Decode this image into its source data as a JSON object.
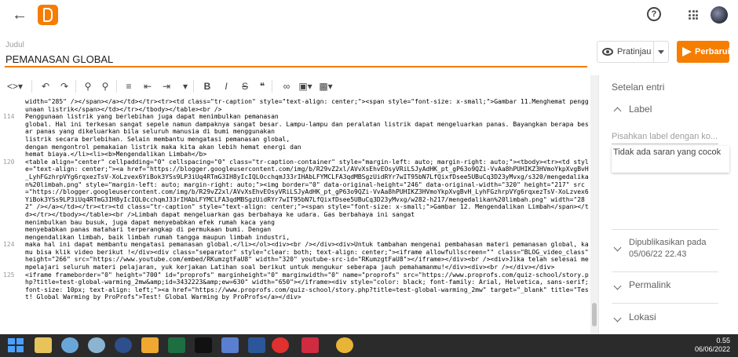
{
  "header": {
    "title_label": "Judul",
    "post_title": "PEMANASAN GLOBAL"
  },
  "actions": {
    "preview_label": "Pratinjau",
    "publish_label": "Perbarui"
  },
  "sidebar": {
    "heading": "Setelan entri",
    "labels_section": "Label",
    "labels_placeholder": "Pisahkan label dengan ko...",
    "suggestion": "Tidak ada saran yang cocok",
    "published_label": "Dipublikasikan pada",
    "published_date": "05/06/22 22.43",
    "permalink": "Permalink",
    "location": "Lokasi"
  },
  "code_lines": [
    {
      "n": "",
      "html": "width=\"285\" /></span></a></td></tr><tr><td class=\"tr-caption\" style=\"text-align: center;\"><span style=\"font-size: x-small;\">Gambar 11.Menghemat penggunaan listrik</span></td></tr></tbody></table><br />"
    },
    {
      "n": "114",
      "html": "Penggunaan listrik yang berlebihan juga dapat menimbulkan pemanasan"
    },
    {
      "n": "",
      "html": "global. Hal ini terkesan sangat sepele namun dampaknya sangat besar. Lampu-lampu dan peralatan listrik dapat mengeluarkan panas. Bayangkan berapa besar panas yang dikeluarkan bila seluruh manusia di bumi menggunakan"
    },
    {
      "n": "",
      "html": "listrik secara berlebihan. Selain membantu mengatasi pemanasan global,"
    },
    {
      "n": "",
      "html": "dengan mengontrol pemakaian listrik maka kita akan lebih hemat energi dan"
    },
    {
      "n": "",
      "html": "hemat biaya.</li><li><b>Mengendalikan Limbah</b>"
    },
    {
      "n": "120",
      "html": "<table align=\"center\" cellpadding=\"0\" cellspacing=\"0\" class=\"tr-caption-container\" style=\"margin-left: auto; margin-right: auto;\"><tbody><tr><td style=\"text-align: center;\"><a href=\"https://blogger.googleusercontent.com/img/b/R29vZ2xl/AVvXsEhvEOsyVRiLSJyAdHK_pt_gP63o9QZi-VvAa8hPUHIKZ3HVmoYkpXvgBvH_LyhFGzhrpVYg6rqxezTsV-XoLzvex6YiBok3YSs9LP3iUq4RTmG3IH8yIcIQL0cchqmJ33rIHAbLFYMCLFA3qdMBSgzUidRYr7wIT95bN7LfQixfDsee5UBuCq3D23yMvxg/s320/mengedalikan%20limbah.png\" style=\"margin-left: auto; margin-right: auto;\"><img border=\"0\" data-original-height=\"246\" data-original-width=\"320\" height=\"217\" src=\"https://blogger.googleusercontent.com/img/b/R29vZ2xl/AVvXsEhvEOsyVRiLSJyAdHK_pt_gP63o9QZi-VvAa8hPUHIKZ3HVmoYkpXvgBvH_LyhFGzhrpVYg6rqxezTsV-XoLzvex6YiBok3YSs9LP3iUq4RTmG3IH8yIcIQL0cchqmJ33rIHAbLFYMCLFA3qdMBSgzUidRYr7wIT95bN7LfQixfDsee5UBuCq3D23yMvxg/w282-h217/mengedalikan%20limbah.png\" width=\"282\" /></a></td></tr><tr><td class=\"tr-caption\" style=\"text-align: center;\"><span style=\"font-size: x-small;\">Gambar 12. Mengendalikan Limbah</span></td></tr></tbody></table><br />Limbah dapat mengeluarkan gas berbahaya ke udara. Gas berbahaya ini sangat"
    },
    {
      "n": "",
      "html": "menimbulkan bau busuk, juga dapat menyebabkan efek rumah kaca yang"
    },
    {
      "n": "",
      "html": "menyebabkan panas matahari terperangkap di permukaan bumi. Dengan"
    },
    {
      "n": "",
      "html": "mengendalikan limbah, baik limbah rumah tangga maupun limbah industri,"
    },
    {
      "n": "124",
      "html": "maka hal ini dapat membantu mengatasi pemanasan global.</li></ol><div><br /></div><div>Untuk tambahan mengenai pembahasan materi pemanasan global, kamu bisa klik video berikut !</div><div class=\"separator\" style=\"clear: both; text-align: center;\"><iframe allowfullscreen=\"\" class=\"BLOG_video_class\" height=\"266\" src=\"https://www.youtube.com/embed/RKumzgtFaU8\" width=\"320\" youtube-src-id=\"RKumzgtFaU8\"></iframe></div><br /><div>Jika telah selesai mempelajari seluruh materi pelajaran, yuk kerjakan Latihan soal berikut untuk mengukur seberapa jauh pemahamanmu!</div><div><br /></div></div>"
    },
    {
      "n": "125",
      "html": "<iframe frameborder=\"0\" height=\"700\" id=\"proprofs\" marginheight=\"0\" marginwidth=\"0\" name=\"proprofs\" src=\"https://www.proprofs.com/quiz-school/story.php?title=test-global-warming_2mw&amp;id=3432223&amp;ew=630\" width=\"650\"></iframe><div style=\"color: black; font-family: Arial, Helvetica, sans-serif; font-size: 10px; text-align: left;\"><a href=\"https://www.proprofs.com/quiz-school/story.php?title=test-global-warming_2mw\" target=\"_blank\" title=\"Test! Global Warming by ProProfs\">Test! Global Warming by ProProfs</a></div>"
    }
  ],
  "tray": {
    "time": "0.55",
    "date": "06/06/2022"
  }
}
